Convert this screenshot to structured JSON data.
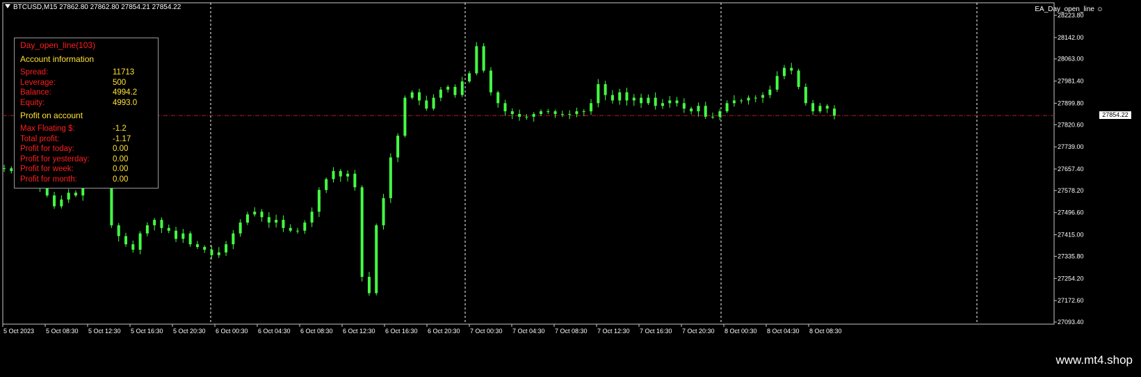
{
  "header": {
    "symbol_line": "BTCUSD,M15  27862.80 27862.80 27854.21 27854.22"
  },
  "indicator": {
    "name": "EA_Day_open_line",
    "icon": "smiley-icon"
  },
  "info_panel": {
    "title": "Day_open_line(103)",
    "account_heading": "Account information",
    "account_rows": [
      {
        "label": "Spread:",
        "value": "11713"
      },
      {
        "label": "Leverage:",
        "value": "500"
      },
      {
        "label": "Balance:",
        "value": "4994.2"
      },
      {
        "label": "Equity:",
        "value": "4993.0"
      }
    ],
    "profit_heading": "Profit on account",
    "profit_rows": [
      {
        "label": "Max Floating $:",
        "value": "-1.2"
      },
      {
        "label": "Total profit:",
        "value": "-1.17"
      },
      {
        "label": "Profit for today:",
        "value": "0.00"
      },
      {
        "label": "Profit for yesterday:",
        "value": "0.00"
      },
      {
        "label": "Profit for week:",
        "value": "0.00"
      },
      {
        "label": "Profit for month:",
        "value": "0.00"
      }
    ]
  },
  "price_axis": {
    "ticks": [
      "28223.80",
      "28142.00",
      "28063.00",
      "27981.40",
      "27899.80",
      "27820.60",
      "27739.00",
      "27657.40",
      "27578.20",
      "27496.60",
      "27415.00",
      "27335.80",
      "27254.20",
      "27172.60",
      "27093.40"
    ],
    "current_price": "27854.22"
  },
  "time_axis": {
    "ticks": [
      "5 Oct 2023",
      "5 Oct 08:30",
      "5 Oct 12:30",
      "5 Oct 16:30",
      "5 Oct 20:30",
      "6 Oct 00:30",
      "6 Oct 04:30",
      "6 Oct 08:30",
      "6 Oct 12:30",
      "6 Oct 16:30",
      "6 Oct 20:30",
      "7 Oct 00:30",
      "7 Oct 04:30",
      "7 Oct 08:30",
      "7 Oct 12:30",
      "7 Oct 16:30",
      "7 Oct 20:30",
      "8 Oct 00:30",
      "8 Oct 04:30",
      "8 Oct 08:30"
    ]
  },
  "chart_data": {
    "type": "line",
    "series": [
      {
        "values": [
          27660,
          27650,
          27640,
          27620,
          27600,
          27590,
          27560,
          27520,
          27545,
          27570,
          27560,
          27610,
          27620,
          27640,
          27600,
          27450,
          27410,
          27380,
          27360,
          27420,
          27450,
          27470,
          27440,
          27430,
          27400,
          27420,
          27380,
          27370,
          27360,
          27340,
          27350,
          27380,
          27420,
          27460,
          27490,
          27500,
          27480,
          27460,
          27470,
          27440,
          27430,
          27430,
          27460,
          27500,
          27580,
          27620,
          27650,
          27630,
          27640,
          27590,
          27260,
          27200,
          27450,
          27550,
          27700,
          27780,
          27920,
          27940,
          27910,
          27880,
          27920,
          27950,
          27960,
          27930,
          27980,
          28010,
          28110,
          28020,
          27940,
          27900,
          27870,
          27860,
          27850,
          27850,
          27860,
          27870,
          27870,
          27860,
          27860,
          27860,
          27870,
          27870,
          27900,
          27970,
          27930,
          27910,
          27940,
          27910,
          27920,
          27900,
          27920,
          27890,
          27900,
          27910,
          27900,
          27880,
          27870,
          27890,
          27850,
          27850,
          27870,
          27900,
          27910,
          27910,
          27920,
          27920,
          27930,
          27950,
          28000,
          28030,
          28020,
          27960,
          27900,
          27870,
          27890,
          27880,
          27854
        ]
      },
      {
        "name": "Day open",
        "values": [
          27854.22
        ]
      }
    ],
    "ylim": [
      27093.4,
      28223.8
    ]
  },
  "footer": {
    "watermark": "www.mt4.shop"
  },
  "colors": {
    "candles": "#44ff44",
    "grid": "#ffffff",
    "price_line": "#b22222",
    "panel_label": "#ff1e1e",
    "panel_value": "#ffe135"
  }
}
